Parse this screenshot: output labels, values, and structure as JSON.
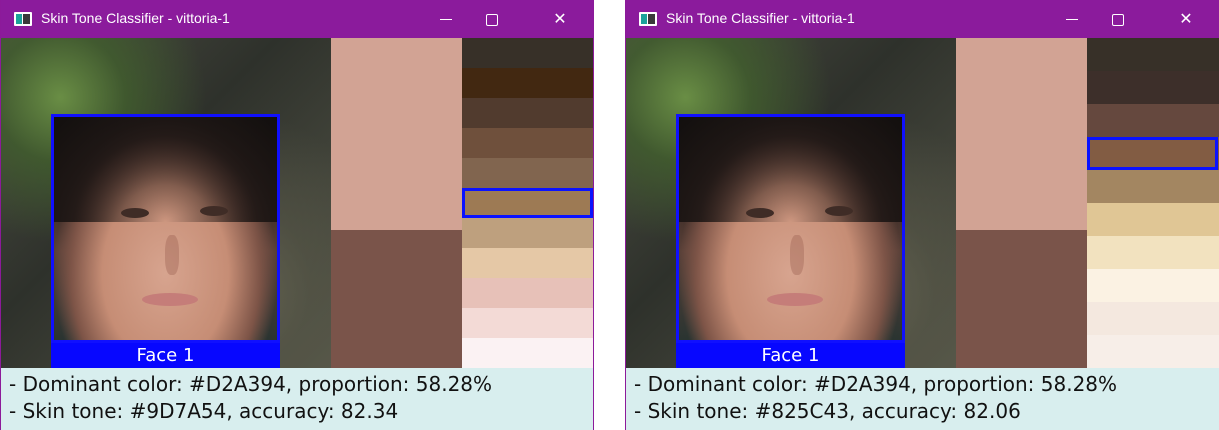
{
  "windows": [
    {
      "title": "Skin Tone Classifier - vittoria-1",
      "face_label": "Face 1",
      "dominant_colors": [
        "#D2A394",
        "#7A544A"
      ],
      "palette": [
        "#373028",
        "#422811",
        "#513B2E",
        "#6F503C",
        "#81654F",
        "#9D7A54",
        "#BEA07E",
        "#E5C8A6",
        "#E7C1B8",
        "#F3DAD6",
        "#FBF2F3"
      ],
      "selected_index": 5,
      "info_lines": [
        "- Dominant color: #D2A394, proportion: 58.28%",
        "- Skin tone: #9D7A54, accuracy: 82.34"
      ]
    },
    {
      "title": "Skin Tone Classifier - vittoria-1",
      "face_label": "Face 1",
      "dominant_colors": [
        "#D2A394",
        "#7A544A"
      ],
      "palette": [
        "#373028",
        "#3D2F2A",
        "#65483E",
        "#825C43",
        "#A38661",
        "#E0C695",
        "#F2E2BF",
        "#FBF2E3",
        "#F4E8DF",
        "#F7EEE8"
      ],
      "selected_index": 3,
      "info_lines": [
        "- Dominant color: #D2A394, proportion: 58.28%",
        "- Skin tone: #825C43, accuracy: 82.06"
      ]
    }
  ]
}
